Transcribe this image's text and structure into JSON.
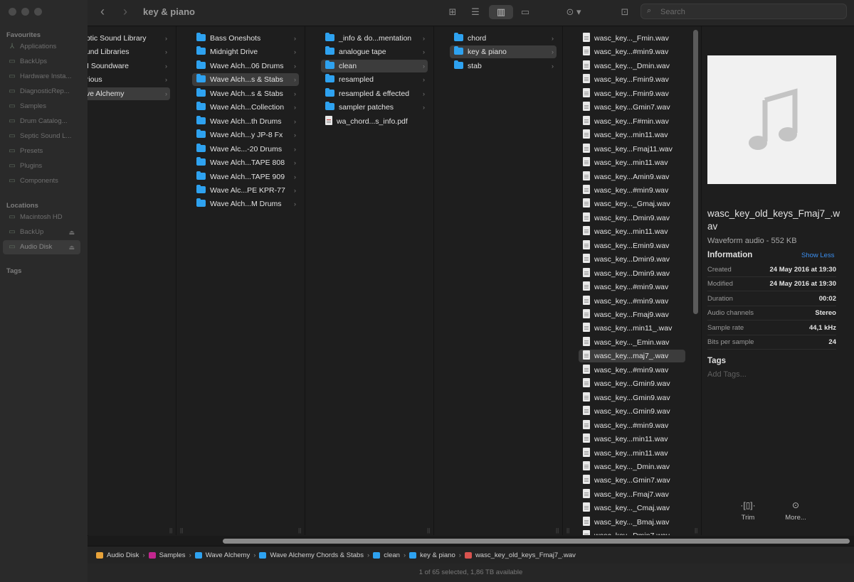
{
  "window": {
    "title": "key & piano"
  },
  "sidebar": {
    "favourites_header": "Favourites",
    "favourites": [
      {
        "label": "Applications",
        "icon": "applications-icon"
      },
      {
        "label": "BackUps",
        "icon": "folder-icon"
      },
      {
        "label": "Hardware Insta...",
        "icon": "folder-icon"
      },
      {
        "label": "DiagnosticRep...",
        "icon": "folder-icon"
      },
      {
        "label": "Samples",
        "icon": "folder-icon"
      },
      {
        "label": "Drum Catalog...",
        "icon": "folder-icon"
      },
      {
        "label": "Septic Sound L...",
        "icon": "folder-icon"
      },
      {
        "label": "Presets",
        "icon": "folder-icon"
      },
      {
        "label": "Plugins",
        "icon": "folder-icon"
      },
      {
        "label": "Components",
        "icon": "folder-icon"
      }
    ],
    "locations_header": "Locations",
    "locations": [
      {
        "label": "Macintosh HD",
        "icon": "disk-icon"
      },
      {
        "label": "BackUp",
        "icon": "disk-icon"
      },
      {
        "label": "Audio Disk",
        "icon": "disk-icon"
      }
    ],
    "tags_header": "Tags"
  },
  "toolbar": {
    "search_placeholder": "Search"
  },
  "columns": {
    "col1": [
      "eptic Sound Library",
      "ound Libraries",
      "VI Soundware",
      "arious",
      "ave Alchemy"
    ],
    "col2": [
      "Bass Oneshots",
      "Midnight Drive",
      "Wave Alch...06 Drums",
      "Wave Alch...s & Stabs",
      "Wave Alch...s & Stabs",
      "Wave Alch...Collection",
      "Wave Alch...th Drums",
      "Wave Alch...y JP-8 Fx",
      "Wave Alc...-20 Drums",
      "Wave Alch...TAPE 808",
      "Wave Alch...TAPE 909",
      "Wave Alc...PE KPR-77",
      "Wave Alch...M Drums"
    ],
    "col3": [
      "_info & do...mentation",
      "analogue tape",
      "clean",
      "resampled",
      "resampled & effected",
      "sampler patches",
      "wa_chord...s_info.pdf"
    ],
    "col4": [
      "chord",
      "key & piano",
      "stab"
    ],
    "col5": [
      "wasc_key..._Fmin.wav",
      "wasc_key...#min9.wav",
      "wasc_key..._Dmin.wav",
      "wasc_key...Fmin9.wav",
      "wasc_key...Fmin9.wav",
      "wasc_key...Gmin7.wav",
      "wasc_key...F#min.wav",
      "wasc_key...min11.wav",
      "wasc_key...Fmaj11.wav",
      "wasc_key...min11.wav",
      "wasc_key...Amin9.wav",
      "wasc_key...#min9.wav",
      "wasc_key..._Gmaj.wav",
      "wasc_key...Dmin9.wav",
      "wasc_key...min11.wav",
      "wasc_key...Emin9.wav",
      "wasc_key...Dmin9.wav",
      "wasc_key...Dmin9.wav",
      "wasc_key...#min9.wav",
      "wasc_key...#min9.wav",
      "wasc_key...Fmaj9.wav",
      "wasc_key...min11_.wav",
      "wasc_key..._Emin.wav",
      "wasc_key...maj7_.wav",
      "wasc_key...#min9.wav",
      "wasc_key...Gmin9.wav",
      "wasc_key...Gmin9.wav",
      "wasc_key...Gmin9.wav",
      "wasc_key...#min9.wav",
      "wasc_key...min11.wav",
      "wasc_key...min11.wav",
      "wasc_key..._Dmin.wav",
      "wasc_key...Gmin7.wav",
      "wasc_key...Fmaj7.wav",
      "wasc_key..._Cmaj.wav",
      "wasc_key..._Bmaj.wav",
      "wasc_key...Dmin7.wav"
    ]
  },
  "preview": {
    "name": "wasc_key_old_keys_Fmaj7_.wav",
    "kind": "Waveform audio - 552 KB",
    "info_header": "Information",
    "show_less": "Show Less",
    "info": [
      {
        "k": "Created",
        "v": "24 May 2016 at 19:30"
      },
      {
        "k": "Modified",
        "v": "24 May 2016 at 19:30"
      },
      {
        "k": "Duration",
        "v": "00:02"
      },
      {
        "k": "Audio channels",
        "v": "Stereo"
      },
      {
        "k": "Sample rate",
        "v": "44,1 kHz"
      },
      {
        "k": "Bits per sample",
        "v": "24"
      }
    ],
    "tags_header": "Tags",
    "tags_placeholder": "Add Tags...",
    "actions": [
      {
        "label": "Trim",
        "icon": "trim-icon"
      },
      {
        "label": "More...",
        "icon": "more-icon"
      }
    ]
  },
  "pathbar": [
    {
      "label": "Audio Disk",
      "color": "#e8a33a"
    },
    {
      "label": "Samples",
      "color": "#c2268f"
    },
    {
      "label": "Wave Alchemy",
      "color": "#2ea2f0"
    },
    {
      "label": "Wave Alchemy Chords & Stabs",
      "color": "#2ea2f0"
    },
    {
      "label": "clean",
      "color": "#2ea2f0"
    },
    {
      "label": "key & piano",
      "color": "#2ea2f0"
    },
    {
      "label": "wasc_key_old_keys_Fmaj7_.wav",
      "color": "#d9534f"
    }
  ],
  "status": "1 of 65 selected, 1,86 TB available"
}
